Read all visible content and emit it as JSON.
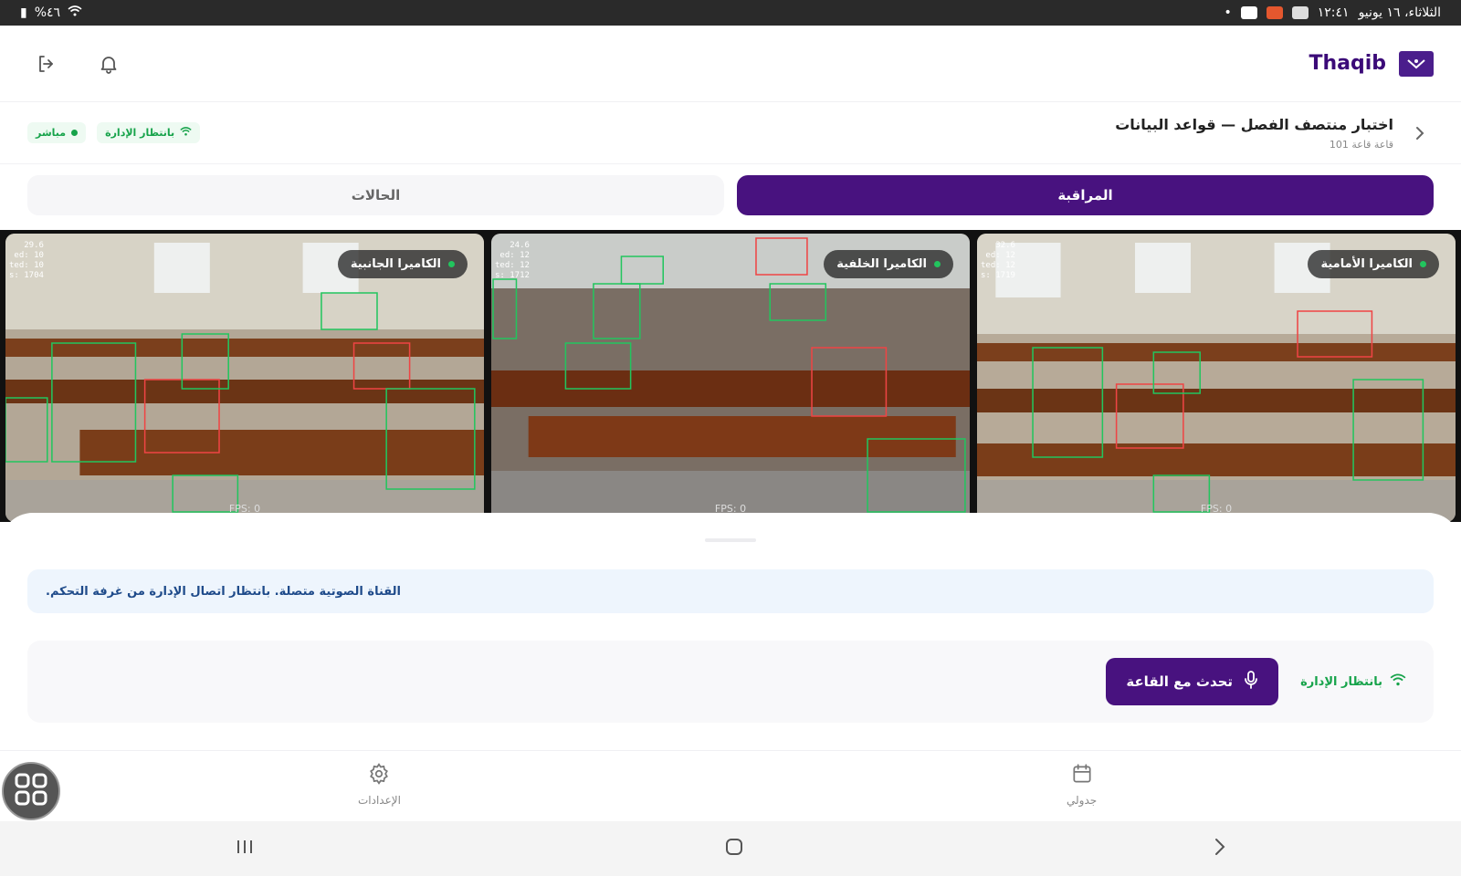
{
  "status_bar": {
    "time": "١٢:٤١",
    "date": "الثلاثاء، ١٦ يونيو",
    "battery": "%٤٦"
  },
  "header": {
    "app_name": "Thaqib",
    "icons": [
      "logout-icon",
      "bell-icon"
    ]
  },
  "exam": {
    "title": "اختبار منتصف الفصل — قواعد البيانات",
    "room": "قاعة قاعة 101",
    "badges": [
      {
        "label": "بانتظار الإدارة",
        "icon": "wifi-icon"
      },
      {
        "label": "مباشر",
        "icon": "dot-icon"
      }
    ]
  },
  "tabs": [
    {
      "label": "المراقبة",
      "active": true
    },
    {
      "label": "الحالات",
      "active": false
    }
  ],
  "cameras": [
    {
      "label": "الكاميرا الأمامية",
      "stats": [
        "32.6",
        "ed: 12",
        "ted: 12",
        "s: 1719"
      ],
      "fps": "FPS: 0"
    },
    {
      "label": "الكاميرا الخلفية",
      "stats": [
        "24.6",
        "ed: 12",
        "ted: 12",
        "s: 1712"
      ],
      "fps": "FPS: 0"
    },
    {
      "label": "الكاميرا الجانبية",
      "stats": [
        "29.6",
        "ed: 10",
        "ted: 10",
        "s: 1704"
      ],
      "fps": "FPS: 0"
    }
  ],
  "notice": "القناة الصوتية متصلة. بانتظار اتصال الإدارة من غرفة التحكم.",
  "audio": {
    "status": "بانتظار الإدارة",
    "talk_button": "تحدث مع القاعة"
  },
  "bottom_nav": {
    "schedule": "جدولي",
    "settings": "الإعدادات"
  },
  "colors": {
    "primary": "#48127f",
    "brand_text": "#3b0a78",
    "success": "#16a34a",
    "notice_bg": "#eef5fd"
  }
}
